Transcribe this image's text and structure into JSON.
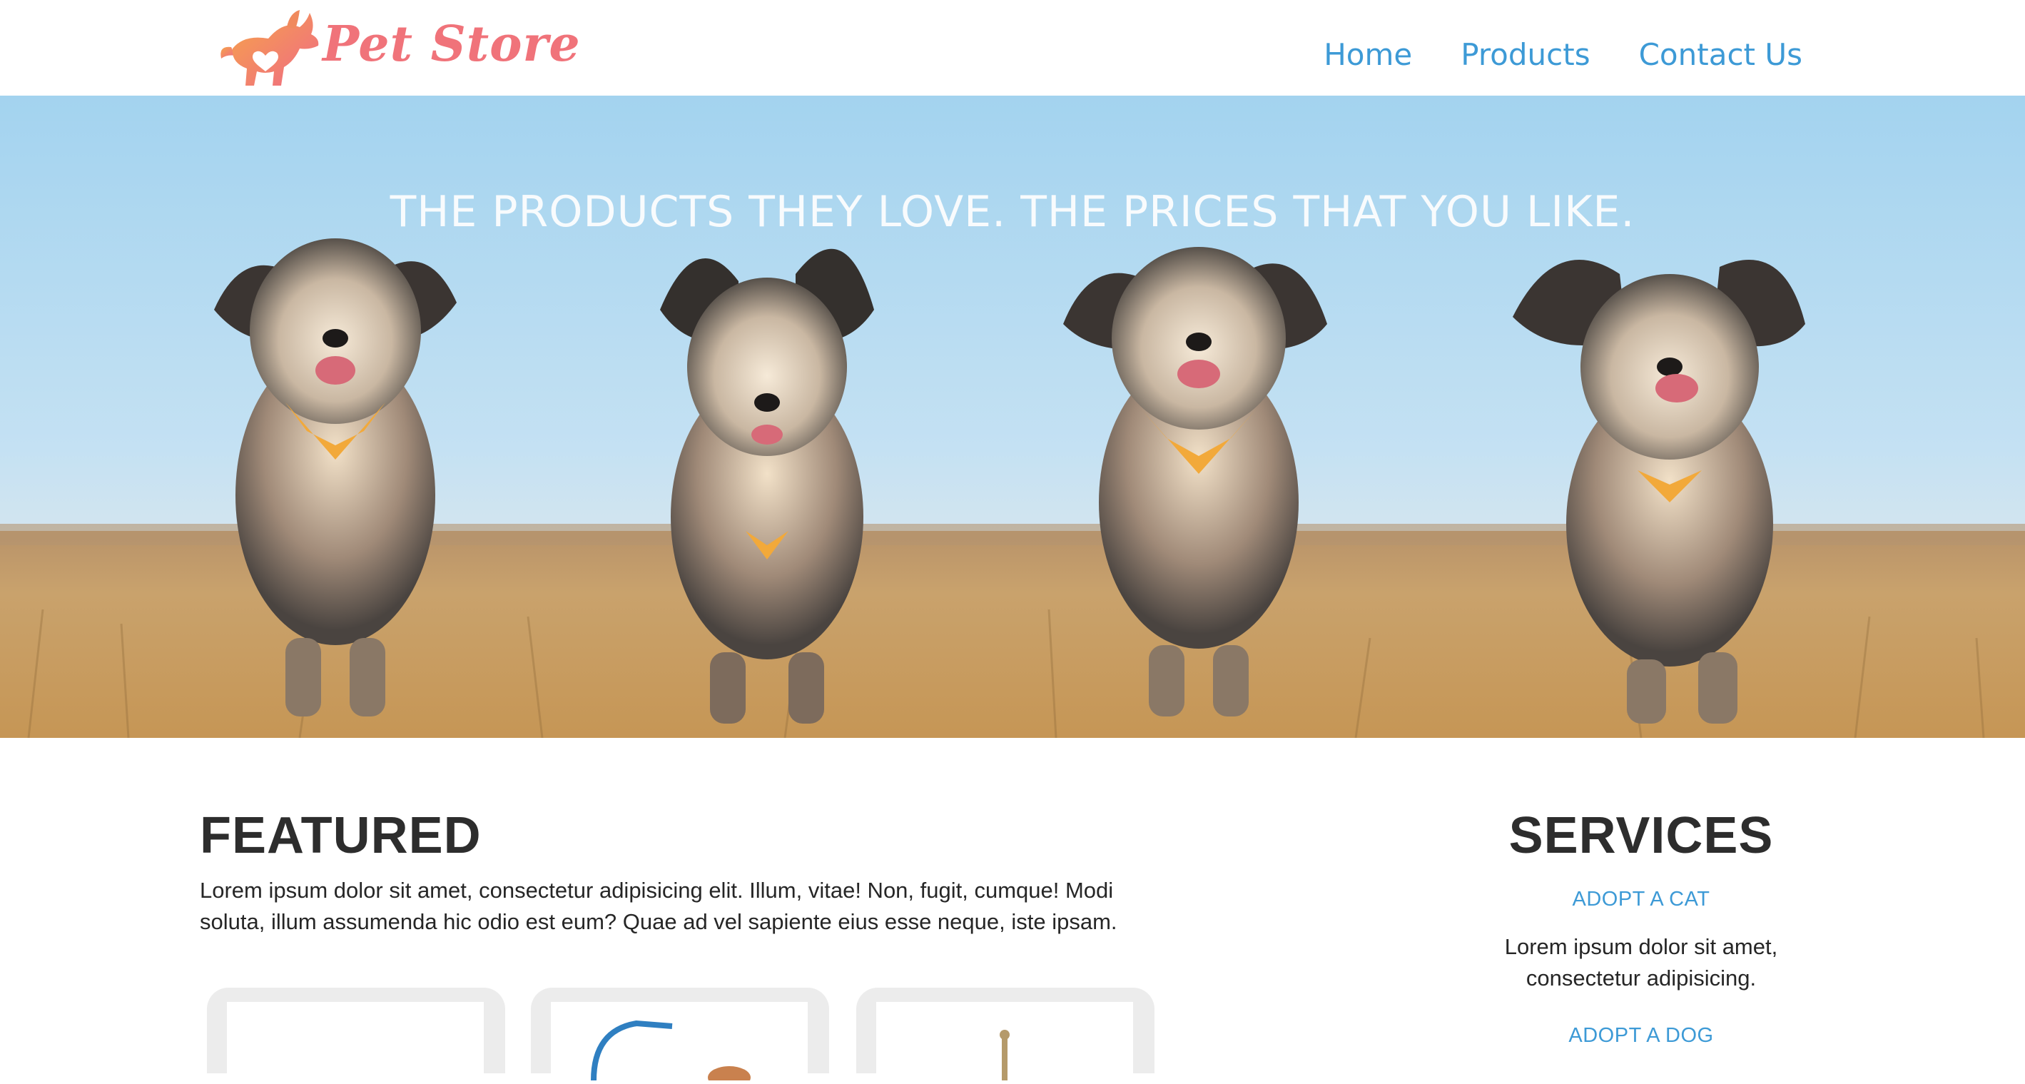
{
  "header": {
    "logo_text": "Pet Store",
    "logo_icon": "dog-heart-logo",
    "nav": [
      {
        "label": "Home"
      },
      {
        "label": "Products"
      },
      {
        "label": "Contact Us"
      }
    ]
  },
  "hero": {
    "tagline": "THE PRODUCTS THEY LOVE. THE PRICES THAT YOU LIKE.",
    "image": "four-dogs-running-in-field"
  },
  "featured": {
    "title": "FEATURED",
    "text": "Lorem ipsum dolor sit amet, consectetur adipisicing elit. Illum, vitae! Non, fugit, cumque! Modi soluta, illum assumenda hic odio est eum? Quae ad vel sapiente eius esse neque, iste ipsam.",
    "cards": [
      {
        "image": "product-image"
      },
      {
        "image": "leash-product-image"
      },
      {
        "image": "toy-product-image"
      }
    ]
  },
  "services": {
    "title": "SERVICES",
    "items": [
      {
        "label": "ADOPT A CAT",
        "text": "Lorem ipsum dolor sit amet, consectetur adipisicing."
      },
      {
        "label": "ADOPT A DOG"
      }
    ]
  },
  "colors": {
    "brand": "#f0737a",
    "link": "#3d9ad6",
    "sky": "#a9d6f0",
    "grass": "#c79a5c"
  }
}
